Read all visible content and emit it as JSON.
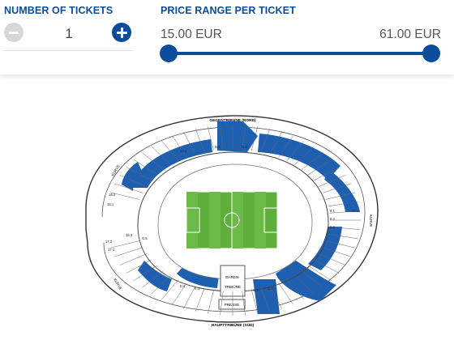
{
  "tickets": {
    "label": "NUMBER OF TICKETS",
    "quantity": "1"
  },
  "price_range": {
    "label": "PRICE RANGE PER TICKET",
    "min": "15.00 EUR",
    "max": "61.00 EUR",
    "selected_min_fraction": 0.0,
    "selected_max_fraction": 1.0
  },
  "colors": {
    "brand": "#0b4c9c",
    "disabled": "#d7d7d7",
    "available_seats": "#1f5fb0",
    "pitch": "#5fae3c"
  },
  "stadium": {
    "north_stand": "GEGENTRIBÜNE (NORD)",
    "south_stand": "HAUPTTRIBÜNE (SÜD)",
    "west_label": "KURVE",
    "west_label_2": "KURVE",
    "east_label": "KURVE",
    "honor_box_line1": "EHREN-",
    "honor_box_line2": "TRIBÜNE",
    "press": "PRESSE",
    "blocks_upper": [
      "16.2",
      "16.1",
      "15.2",
      "15.1",
      "14.1",
      "N.2",
      "N.1",
      "11.1",
      "N.3"
    ],
    "blocks_left": [
      "18.2",
      "18.1",
      "17.2",
      "17.1",
      "16.3"
    ],
    "blocks_lower_left": [
      "17.2",
      "16.1",
      "15.1",
      "15.2",
      "G.5",
      "G.2",
      "G.3"
    ],
    "blocks_right": [
      "8.2",
      "8.3",
      "9.1",
      "9.2",
      "10.1",
      "10.2",
      "22.1",
      "22.2",
      "8.1",
      "7.2",
      "7.1",
      "6.1",
      "6.2",
      "6.3"
    ],
    "blocks_bottom": [
      "E.4",
      "E.3",
      "E.2",
      "E.1",
      "C.1",
      "C.2",
      "C.3",
      "C.4",
      "O.1",
      "O.2",
      "O.3",
      "O.4",
      "E.5",
      "E.6"
    ]
  }
}
